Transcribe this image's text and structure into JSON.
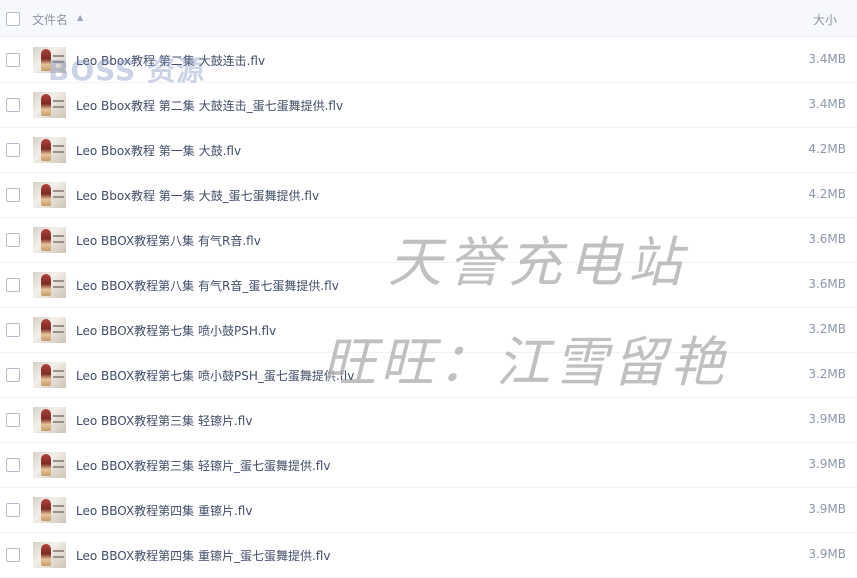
{
  "header": {
    "name_label": "文件名",
    "size_label": "大小",
    "sort_icon": "▲"
  },
  "files": [
    {
      "name": "Leo Bbox教程 第二集 大鼓连击.flv",
      "size": "3.4MB"
    },
    {
      "name": "Leo Bbox教程 第二集 大鼓连击_蛋七蛋舞提供.flv",
      "size": "3.4MB"
    },
    {
      "name": "Leo Bbox教程 第一集 大鼓.flv",
      "size": "4.2MB"
    },
    {
      "name": "Leo Bbox教程 第一集 大鼓_蛋七蛋舞提供.flv",
      "size": "4.2MB"
    },
    {
      "name": "Leo BBOX教程第八集 有气R音.flv",
      "size": "3.6MB"
    },
    {
      "name": "Leo BBOX教程第八集 有气R音_蛋七蛋舞提供.flv",
      "size": "3.6MB"
    },
    {
      "name": "Leo BBOX教程第七集 喷小鼓PSH.flv",
      "size": "3.2MB"
    },
    {
      "name": "Leo BBOX教程第七集 喷小鼓PSH_蛋七蛋舞提供.flv",
      "size": "3.2MB"
    },
    {
      "name": "Leo BBOX教程第三集 轻镲片.flv",
      "size": "3.9MB"
    },
    {
      "name": "Leo BBOX教程第三集 轻镲片_蛋七蛋舞提供.flv",
      "size": "3.9MB"
    },
    {
      "name": "Leo BBOX教程第四集 重镲片.flv",
      "size": "3.9MB"
    },
    {
      "name": "Leo BBOX教程第四集 重镲片_蛋七蛋舞提供.flv",
      "size": "3.9MB"
    }
  ],
  "watermarks": {
    "brand": "BOSS 资源",
    "line1": "天誉充电站",
    "line2": "旺旺：江雪留艳"
  }
}
